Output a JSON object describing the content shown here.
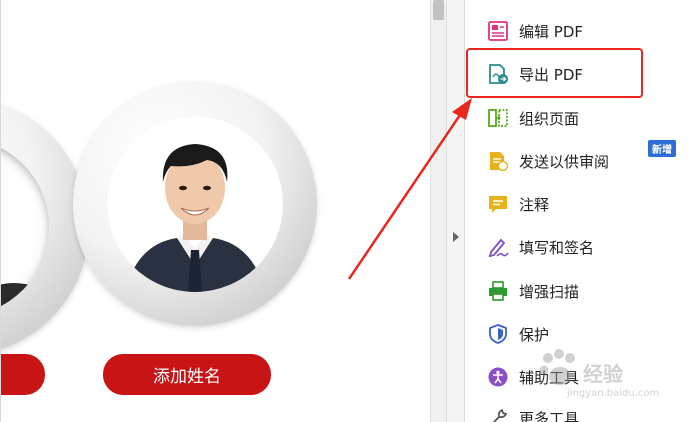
{
  "document": {
    "button_label": "添加姓名"
  },
  "tools": {
    "items": [
      {
        "label": "编辑 PDF",
        "icon": "edit-pdf-icon",
        "color": "#e0327f"
      },
      {
        "label": "导出 PDF",
        "icon": "export-pdf-icon",
        "color": "#2a8c8c"
      },
      {
        "label": "组织页面",
        "icon": "organize-pages-icon",
        "color": "#5aa81f"
      },
      {
        "label": "发送以供审阅",
        "icon": "send-review-icon",
        "color": "#e8b21d"
      },
      {
        "label": "注释",
        "icon": "comment-icon",
        "color": "#e8b21d"
      },
      {
        "label": "填写和签名",
        "icon": "fill-sign-icon",
        "color": "#7a4fc7"
      },
      {
        "label": "增强扫描",
        "icon": "enhance-scan-icon",
        "color": "#2f9a2f"
      },
      {
        "label": "保护",
        "icon": "protect-icon",
        "color": "#3a63c7"
      },
      {
        "label": "辅助工具",
        "icon": "accessibility-icon",
        "color": "#8a4fc7"
      },
      {
        "label": "更多工具",
        "icon": "more-tools-icon",
        "color": "#555555"
      }
    ],
    "new_badge": "新增"
  },
  "watermark": {
    "text": "经验",
    "sub": "jingyan.baidu.com"
  },
  "colors": {
    "highlight": "#e8281e",
    "button": "#c81414",
    "badge": "#2b6fd6"
  }
}
